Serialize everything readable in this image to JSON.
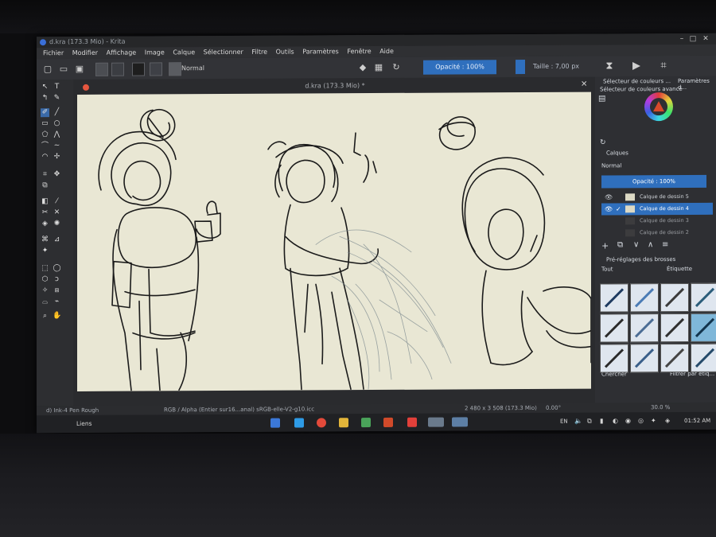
{
  "window": {
    "title": "d.kra (173.3 Mio) - Krita"
  },
  "menu": [
    "Fichier",
    "Modifier",
    "Affichage",
    "Image",
    "Calque",
    "Sélectionner",
    "Filtre",
    "Outils",
    "Paramètres",
    "Fenêtre",
    "Aide"
  ],
  "toolbar": {
    "blend_mode": "Normal",
    "opacity_label": "Opacité : 100%",
    "size_label": "Taille : 7,00 px"
  },
  "document": {
    "tab_title": "d.kra (173.3 Mio) *"
  },
  "docker": {
    "color_selector_tab": "Sélecteur de couleurs ...",
    "params_tab": "Paramètres d...",
    "advanced_selector": "Sélecteur de couleurs avancé",
    "layers_title": "Calques",
    "layers_blend": "Normal",
    "layers_opacity": "Opacité : 100%",
    "layers": [
      {
        "name": "Calque de dessin 5",
        "active": false
      },
      {
        "name": "Calque de dessin 4",
        "active": true
      },
      {
        "name": "Calque de dessin 3",
        "active": false
      },
      {
        "name": "Calque de dessin 2",
        "active": false
      }
    ],
    "presets_title": "Pré-réglages des brosses",
    "presets_filter": "Tout",
    "presets_tag": "Étiquette",
    "search_placeholder": "Chercher",
    "filter_label": "Filtrer par étiq..."
  },
  "status": {
    "brush": "d) Ink-4 Pen Rough",
    "colorspace": "RGB / Alpha (Entier sur16...anal) sRGB-elle-V2-g10.icc",
    "dimensions": "2 480 x 3 508 (173.3 Mio)",
    "rotation": "0.00°",
    "zoom": "30.0 %"
  },
  "taskbar": {
    "links_label": "Liens",
    "language": "EN",
    "time": "01:52 AM"
  },
  "colors": {
    "accent": "#2f6fbd",
    "canvas": "#e9e7d4",
    "panel": "#2e2f33",
    "ink": "#1a1a1a"
  }
}
